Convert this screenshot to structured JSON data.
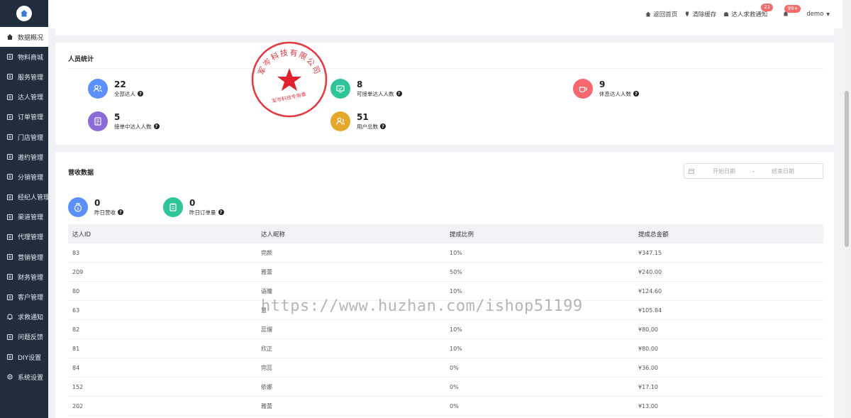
{
  "sidebar": {
    "items": [
      {
        "label": "数据概况",
        "icon": "home-icon",
        "active": true
      },
      {
        "label": "物料商城",
        "icon": "shop-icon"
      },
      {
        "label": "服务管理",
        "icon": "service-icon"
      },
      {
        "label": "达人管理",
        "icon": "user-icon"
      },
      {
        "label": "订单管理",
        "icon": "order-icon"
      },
      {
        "label": "门店管理",
        "icon": "store-icon"
      },
      {
        "label": "邀约管理",
        "icon": "invite-icon"
      },
      {
        "label": "分销管理",
        "icon": "distribution-icon"
      },
      {
        "label": "经纪人管理",
        "icon": "agent-icon"
      },
      {
        "label": "渠道管理",
        "icon": "channel-icon"
      },
      {
        "label": "代理管理",
        "icon": "proxy-icon"
      },
      {
        "label": "营销管理",
        "icon": "marketing-icon"
      },
      {
        "label": "财务管理",
        "icon": "finance-icon"
      },
      {
        "label": "客户管理",
        "icon": "customer-icon"
      },
      {
        "label": "求救通知",
        "icon": "bell-icon"
      },
      {
        "label": "问题反馈",
        "icon": "feedback-icon"
      },
      {
        "label": "DIY设置",
        "icon": "diy-icon"
      },
      {
        "label": "系统设置",
        "icon": "gear-icon"
      }
    ]
  },
  "header": {
    "home_link": "返回首页",
    "clear_cache": "清除缓存",
    "sos_notice": "达人求救通知",
    "sos_badge": "21",
    "notice_badge": "99+",
    "user": "demo"
  },
  "staff": {
    "title": "人员统计",
    "stats": [
      {
        "value": "22",
        "label": "全部达人",
        "color": "#5b8ff9"
      },
      {
        "value": "5",
        "label": "接单中达人人数",
        "color": "#8c6ad8"
      },
      {
        "value": "8",
        "label": "可接单达人人数",
        "color": "#2fc39a"
      },
      {
        "value": "51",
        "label": "用户总数",
        "color": "#e5a82c"
      },
      {
        "value": "9",
        "label": "休息达人人数",
        "color": "#f6686e"
      }
    ]
  },
  "revenue": {
    "title": "营收数据",
    "start_placeholder": "开始日期",
    "separator": "-",
    "end_placeholder": "结束日期",
    "stats": [
      {
        "value": "0",
        "label": "昨日营收",
        "color": "#5b8ff9"
      },
      {
        "value": "0",
        "label": "昨日订单量",
        "color": "#2fc39a"
      }
    ],
    "columns": [
      "达人ID",
      "达人昵称",
      "提成比例",
      "提成总金额"
    ],
    "rows": [
      [
        "83",
        "完颜",
        "10%",
        "¥347.15"
      ],
      [
        "209",
        "雅蕾",
        "50%",
        "¥240.00"
      ],
      [
        "80",
        "语瞳",
        "10%",
        "¥124.60"
      ],
      [
        "63",
        "慧",
        "",
        "¥105.84"
      ],
      [
        "82",
        "蕊熘",
        "10%",
        "¥80.00"
      ],
      [
        "81",
        "欣正",
        "10%",
        "¥80.00"
      ],
      [
        "84",
        "完蕊",
        "0%",
        "¥36.00"
      ],
      [
        "152",
        "依娜",
        "0%",
        "¥17.10"
      ],
      [
        "202",
        "雅蕾",
        "0%",
        "¥13.00"
      ]
    ]
  },
  "stamp": {
    "top_text": "军岑科技有限公司",
    "bottom_text": "军岑科技专用章",
    "color": "#e0202a"
  },
  "watermark": "https://www.huzhan.com/ishop51199"
}
